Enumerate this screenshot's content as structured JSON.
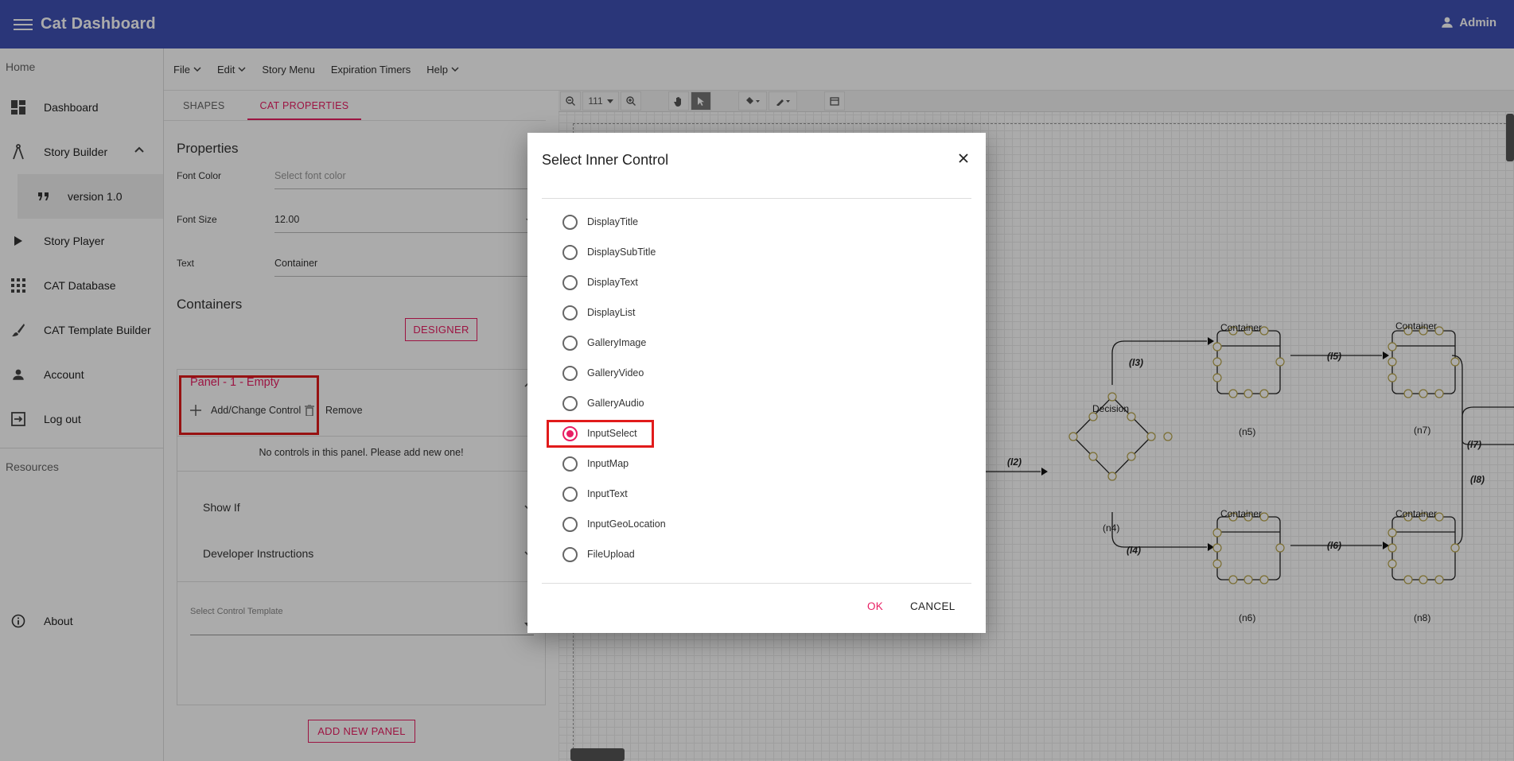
{
  "app": {
    "title": "Cat Dashboard",
    "user": "Admin"
  },
  "sidebar": {
    "home_label": "Home",
    "items": [
      {
        "label": "Dashboard",
        "icon": "dashboard-icon"
      },
      {
        "label": "Story Builder",
        "icon": "compass-icon"
      },
      {
        "label": "version 1.0",
        "icon": "quote-icon"
      },
      {
        "label": "Story Player",
        "icon": "play-icon"
      },
      {
        "label": "CAT Database",
        "icon": "grid-icon"
      },
      {
        "label": "CAT Template Builder",
        "icon": "brush-icon"
      },
      {
        "label": "Account",
        "icon": "person-icon"
      },
      {
        "label": "Log out",
        "icon": "logout-icon"
      }
    ],
    "resources_label": "Resources",
    "about_label": "About"
  },
  "menubar": {
    "file": "File",
    "edit": "Edit",
    "story_menu": "Story Menu",
    "expiration_timers": "Expiration Timers",
    "help": "Help"
  },
  "props": {
    "tabs": [
      "SHAPES",
      "CAT PROPERTIES"
    ],
    "properties_heading": "Properties",
    "font_color_label": "Font Color",
    "font_color_placeholder": "Select font color",
    "font_size_label": "Font Size",
    "font_size_value": "12.00",
    "text_label": "Text",
    "text_value": "Container",
    "containers_heading": "Containers",
    "designer_button": "DESIGNER",
    "panel_title": "Panel - 1 - Empty",
    "add_change_control": "Add/Change Control",
    "remove": "Remove",
    "no_controls": "No controls in this panel. Please add new one!",
    "show_if": "Show If",
    "developer_instructions": "Developer Instructions",
    "select_control_template": "Select Control Template",
    "add_new_panel": "ADD NEW PANEL"
  },
  "canvas": {
    "zoom": "111",
    "nodes": [
      {
        "title": "Container",
        "id": "(n5)"
      },
      {
        "title": "Container",
        "id": "(n7)"
      },
      {
        "title": "Decision",
        "id": "(n4)"
      },
      {
        "title": "Container",
        "id": "(n6)"
      },
      {
        "title": "Container",
        "id": "(n8)"
      }
    ],
    "edges": [
      "(l2)",
      "(l3)",
      "(l4)",
      "(l5)",
      "(l6)",
      "(l7)",
      "(l8)"
    ]
  },
  "dialog": {
    "title": "Select Inner Control",
    "options": [
      "DisplayTitle",
      "DisplaySubTitle",
      "DisplayText",
      "DisplayList",
      "GalleryImage",
      "GalleryVideo",
      "GalleryAudio",
      "InputSelect",
      "InputMap",
      "InputText",
      "InputGeoLocation",
      "FileUpload"
    ],
    "selected": "InputSelect",
    "ok": "OK",
    "cancel": "CANCEL"
  },
  "colors": {
    "appbar": "#3f51b5",
    "accent": "#e91e63",
    "highlight": "#e11b1b"
  }
}
